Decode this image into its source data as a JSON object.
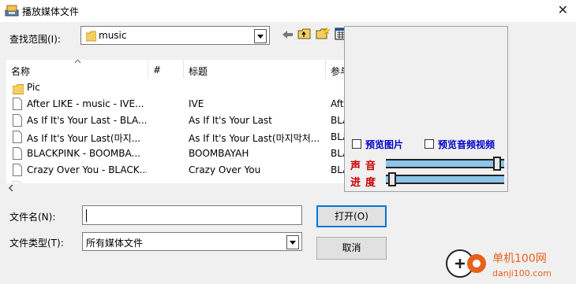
{
  "window": {
    "title": "播放媒体文件",
    "close_glyph": "✕"
  },
  "lookin": {
    "label": "查找范围(I):",
    "value": "music"
  },
  "list": {
    "headers": [
      "名称",
      "#",
      "标题",
      "参与"
    ],
    "rows": [
      {
        "name": "Pic",
        "num": "",
        "title": "",
        "artist": "",
        "type": "folder"
      },
      {
        "name": "After LIKE - music - IVE...",
        "num": "",
        "title": "IVE",
        "artist": "Aft",
        "type": "file"
      },
      {
        "name": "As If It's Your Last - BLA...",
        "num": "",
        "title": "As If It's Your Last",
        "artist": "BLA",
        "type": "file"
      },
      {
        "name": "As If It's Your Last(마지...",
        "num": "",
        "title": "As If It's Your Last(마지막처...",
        "artist": "BLA",
        "type": "file"
      },
      {
        "name": "BLACKPINK - BOOMBA...",
        "num": "",
        "title": "BOOMBAYAH",
        "artist": "BLA",
        "type": "file"
      },
      {
        "name": "Crazy Over You - BLACK...",
        "num": "",
        "title": "Crazy Over You",
        "artist": "BLA",
        "type": "file"
      }
    ]
  },
  "preview": {
    "preview_image_label": "预览图片",
    "preview_av_label": "预览音频视频",
    "volume_label": "声音",
    "progress_label": "进度",
    "volume_level": 0.97,
    "progress_level": 0.02
  },
  "filename": {
    "label": "文件名(N):",
    "value": ""
  },
  "filetype": {
    "label": "文件类型(T):",
    "value": "所有媒体文件"
  },
  "buttons": {
    "open": "打开(O)",
    "cancel": "取消"
  },
  "watermark": {
    "brand": "单机100网",
    "url": "danji100.com"
  },
  "colors": {
    "accent": "#0078d7",
    "preview_blue": "#0000c8",
    "preview_red": "#c80000",
    "slider_fill": "#8bc6ea",
    "watermark_orange": "#e8601a"
  },
  "icons": [
    "app-icon",
    "close-icon",
    "folder-icon",
    "back-icon",
    "up-folder-icon",
    "new-folder-icon",
    "view-menu-icon",
    "file-icon",
    "scroll-left-icon",
    "dropdown-arrow-icon",
    "sort-arrow-icon"
  ]
}
